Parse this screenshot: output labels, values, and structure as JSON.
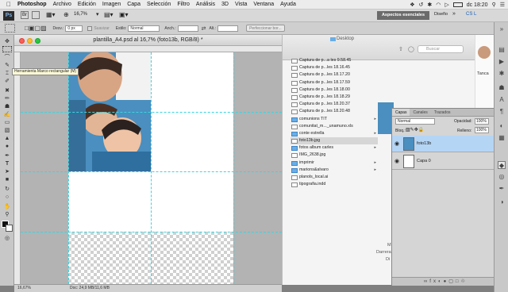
{
  "menubar": {
    "apple": "",
    "app_name": "Photoshop",
    "items": [
      "Archivo",
      "Edición",
      "Imagen",
      "Capa",
      "Selección",
      "Filtro",
      "Análisis",
      "3D",
      "Vista",
      "Ventana",
      "Ayuda"
    ],
    "clock": "dc 18:20"
  },
  "appbar": {
    "ps_logo": "Ps",
    "zoom": "16,7%",
    "workspace_active": "Aspectos esenciales",
    "workspace_design": "Diseño",
    "cslive": "CS L"
  },
  "options": {
    "feather_label": "Desv.:",
    "feather_value": "0 px",
    "smooth_label": "Suavizar",
    "style_label": "Estilo:",
    "style_value": "Normal",
    "width_label": "Anch.:",
    "height_label": "Alt.:",
    "refine_button": "Perfeccionar bor..."
  },
  "document": {
    "title": "plantilla_A4.psd al 16,7% (foto13b, RGB/8) *",
    "zoom_status": "16,67%",
    "doc_status": "Doc: 24,9 MB/11,6 MB"
  },
  "tooltip": "Herramienta Marco rectangular (M)",
  "finder": {
    "title": "Desktop",
    "search_placeholder": "Buscar",
    "files": [
      {
        "name": "Captura de p...a les 9.58.45",
        "type": "file"
      },
      {
        "name": "Captura de p...les 18.16.45",
        "type": "file"
      },
      {
        "name": "Captura de p...les 18.17.20",
        "type": "file"
      },
      {
        "name": "Captura de p...les 18.17.59",
        "type": "file"
      },
      {
        "name": "Captura de p...les 18.18.00",
        "type": "file"
      },
      {
        "name": "Captura de p...les 18.18.29",
        "type": "file"
      },
      {
        "name": "Captura de p...les 18.20.37",
        "type": "file"
      },
      {
        "name": "Captura de p...les 18.20.48",
        "type": "file"
      },
      {
        "name": "comunions TIT",
        "type": "folder"
      },
      {
        "name": "comunitat_m..._unamuno.xls",
        "type": "file"
      },
      {
        "name": "conte estrella",
        "type": "folder"
      },
      {
        "name": "foto13b.jpg",
        "type": "file",
        "selected": true
      },
      {
        "name": "fotos album carles",
        "type": "folder"
      },
      {
        "name": "IMG_2638.jpg",
        "type": "file"
      },
      {
        "name": "imprimir",
        "type": "folder"
      },
      {
        "name": "marions&alvaro",
        "type": "folder"
      },
      {
        "name": "planols_local.ai",
        "type": "file"
      },
      {
        "name": "tipografia.indd",
        "type": "file"
      }
    ],
    "side_partial_1": "Tanca",
    "preview_text_1": "M",
    "preview_text_2": "Darrera",
    "preview_text_3": "Di"
  },
  "layers_panel": {
    "tabs": [
      "Capas",
      "Canales",
      "Trazados"
    ],
    "blend_mode": "Normal",
    "opacity_label": "Opacidad:",
    "opacity_value": "100%",
    "lock_label": "Bloq.:",
    "fill_label": "Relleno:",
    "fill_value": "100%",
    "layers": [
      {
        "name": "foto13b",
        "selected": true
      },
      {
        "name": "Capa 0",
        "selected": false
      }
    ]
  },
  "colors": {
    "guide": "#39d5e0",
    "selection": "#b5d5f5",
    "workspace_button": "#6b6b6b"
  }
}
